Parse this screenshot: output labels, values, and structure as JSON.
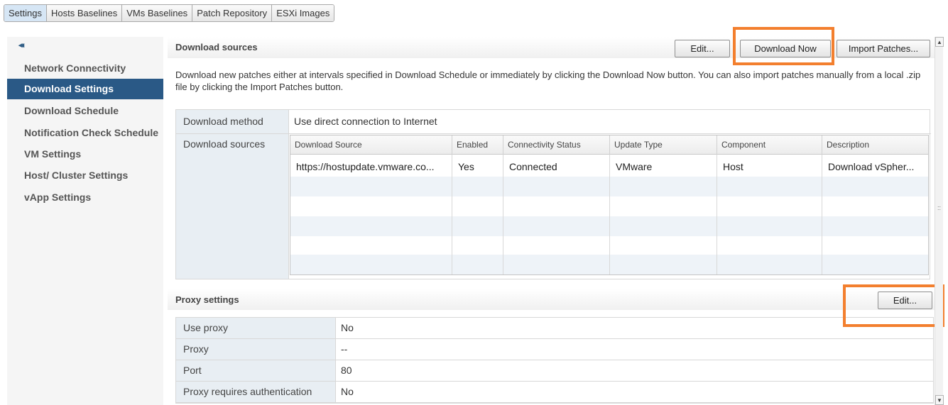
{
  "tabs": [
    "Settings",
    "Hosts Baselines",
    "VMs Baselines",
    "Patch Repository",
    "ESXi Images"
  ],
  "nav": {
    "collapse_glyph": "◂◂",
    "items": [
      "Network Connectivity",
      "Download Settings",
      "Download Schedule",
      "Notification Check Schedule",
      "VM Settings",
      "Host/ Cluster Settings",
      "vApp Settings"
    ],
    "active": "Download Settings"
  },
  "download_sources": {
    "title": "Download sources",
    "edit_label": "Edit...",
    "download_now_label": "Download Now",
    "import_label": "Import Patches...",
    "description": "Download new patches either at intervals specified in Download Schedule or immediately by clicking the Download Now button. You can also import patches manually from a local .zip file by clicking the Import Patches button.",
    "method_label": "Download method",
    "method_value": "Use direct connection to Internet",
    "sources_label": "Download sources",
    "columns": [
      "Download Source",
      "Enabled",
      "Connectivity Status",
      "Update Type",
      "Component",
      "Description"
    ],
    "rows": [
      [
        "https://hostupdate.vmware.co...",
        "Yes",
        "Connected",
        "VMware",
        "Host",
        "Download vSpher..."
      ]
    ]
  },
  "proxy": {
    "title": "Proxy settings",
    "edit_label": "Edit...",
    "rows": [
      {
        "label": "Use proxy",
        "value": "No"
      },
      {
        "label": "Proxy",
        "value": "--"
      },
      {
        "label": "Port",
        "value": "80"
      },
      {
        "label": "Proxy requires authentication",
        "value": "No"
      }
    ]
  },
  "colors": {
    "highlight": "#f37f2e",
    "nav_active": "#2a5986"
  },
  "scrollbar": {
    "up_glyph": "▲",
    "down_glyph": "▼",
    "grip_glyph": "::"
  }
}
